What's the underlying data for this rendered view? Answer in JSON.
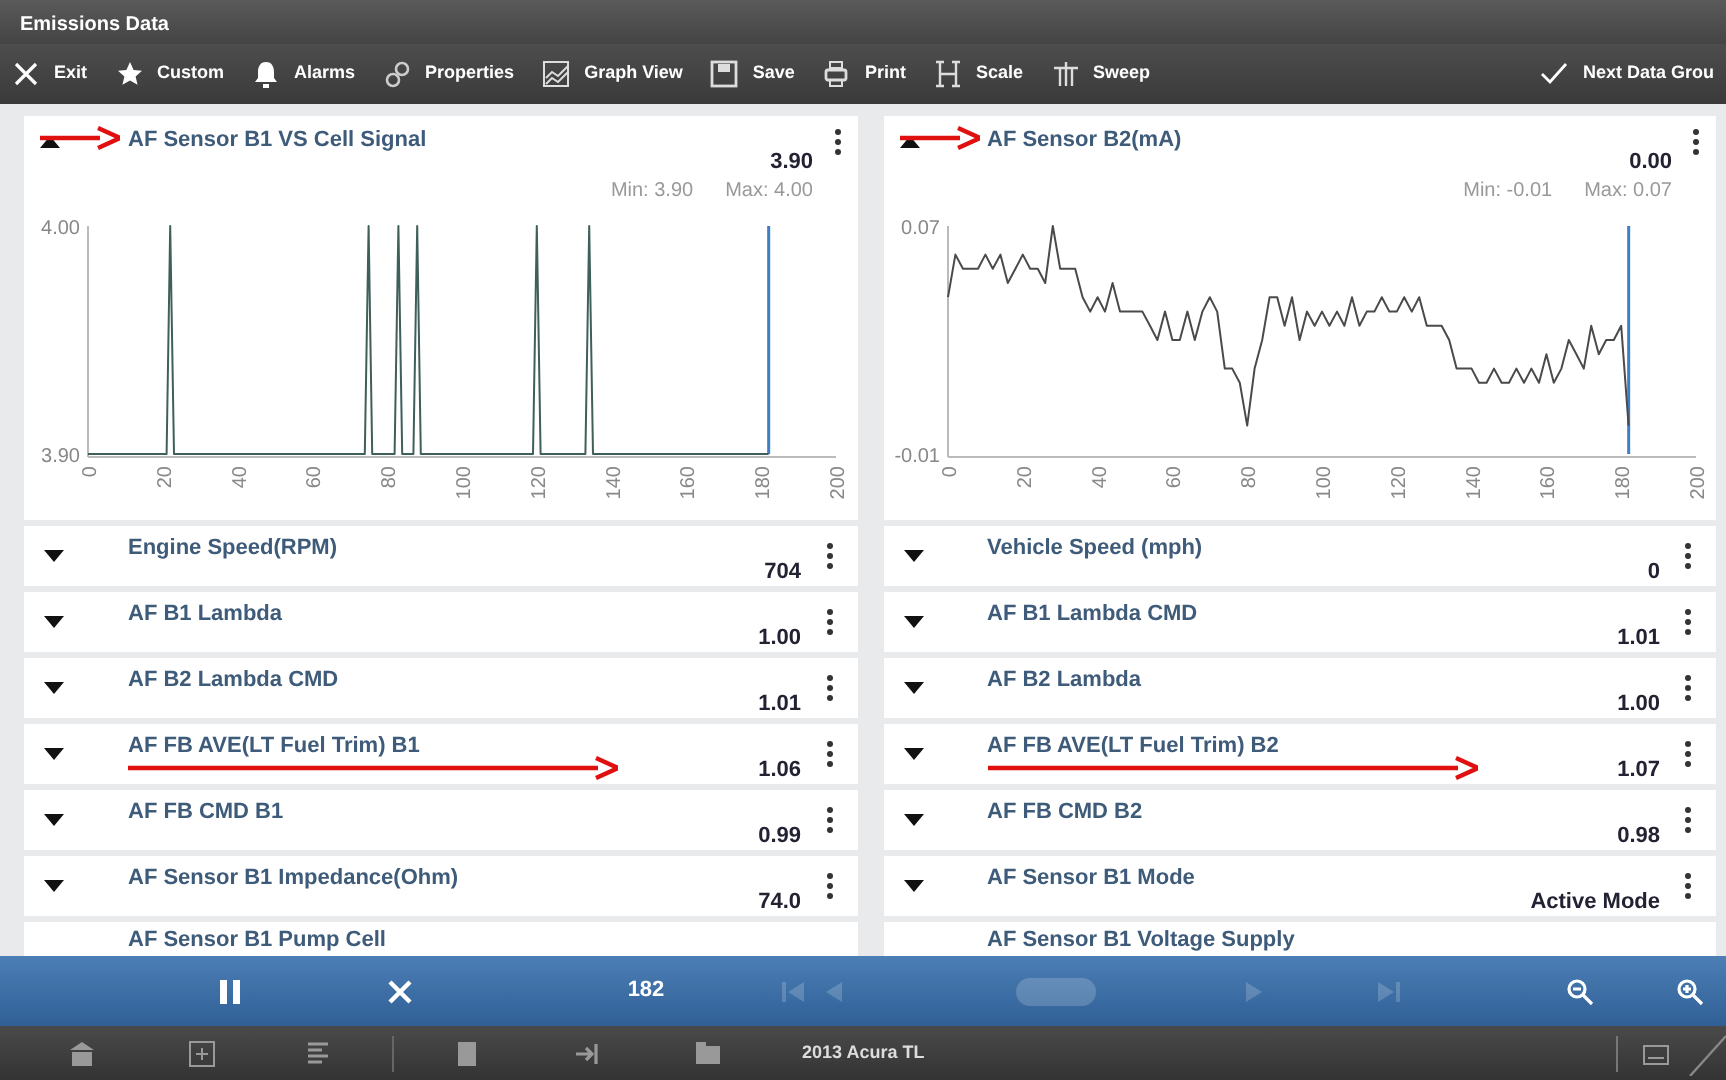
{
  "window": {
    "title": "Emissions Data"
  },
  "toolbar": [
    {
      "kind": "close",
      "label": "Exit"
    },
    {
      "kind": "star",
      "label": "Custom"
    },
    {
      "kind": "bell",
      "label": "Alarms"
    },
    {
      "kind": "gears",
      "label": "Properties"
    },
    {
      "kind": "graph",
      "label": "Graph View"
    },
    {
      "kind": "save",
      "label": "Save"
    },
    {
      "kind": "print",
      "label": "Print"
    },
    {
      "kind": "scale",
      "label": "Scale"
    },
    {
      "kind": "sweep",
      "label": "Sweep"
    },
    {
      "kind": "check",
      "label": "Next Data Grou"
    }
  ],
  "panels": [
    {
      "chart": {
        "title": "AF Sensor B1 VS Cell Signal",
        "value": "3.90",
        "min": "Min: 3.90",
        "max": "Max: 4.00",
        "expanded": true,
        "annotated": true,
        "chart_data": {
          "type": "line",
          "x": [
            0,
            21,
            22,
            23,
            74,
            75,
            76,
            82,
            83,
            84,
            87,
            88,
            89,
            119,
            120,
            121,
            133,
            134,
            135,
            181,
            182
          ],
          "series": [
            {
              "color": "#3f5f5a",
              "values": [
                3.9,
                3.9,
                4.0,
                3.9,
                3.9,
                4.0,
                3.9,
                3.9,
                4.0,
                3.9,
                3.9,
                4.0,
                3.9,
                3.9,
                4.0,
                3.9,
                3.9,
                4.0,
                3.9,
                3.9,
                3.9
              ]
            }
          ],
          "xlim": [
            0,
            200
          ],
          "ylim": [
            3.9,
            4.0
          ],
          "xticks": [
            0,
            20,
            40,
            60,
            80,
            100,
            120,
            140,
            160,
            180,
            200
          ],
          "yticks": [
            {
              "value": 3.9,
              "label": "3.90"
            },
            {
              "value": 4.0,
              "label": "4.00"
            }
          ],
          "ref_lines": [
            {
              "axis": "x",
              "value": 182,
              "color": "#3d7fc4"
            }
          ]
        }
      },
      "rows": [
        {
          "name": "Engine Speed(RPM)",
          "value": "704",
          "expanded": false,
          "annotated": false
        },
        {
          "name": "AF B1 Lambda",
          "value": "1.00",
          "expanded": false,
          "annotated": false
        },
        {
          "name": "AF B2 Lambda CMD",
          "value": "1.01",
          "expanded": false,
          "annotated": false
        },
        {
          "name": "AF FB AVE(LT Fuel Trim) B1",
          "value": "1.06",
          "expanded": false,
          "annotated": true
        },
        {
          "name": "AF FB CMD B1",
          "value": "0.99",
          "expanded": false,
          "annotated": false
        },
        {
          "name": "AF Sensor B1 Impedance(Ohm)",
          "value": "74.0",
          "expanded": false,
          "annotated": false
        },
        {
          "name": "AF Sensor B1 Pump Cell",
          "annotated": false
        }
      ]
    },
    {
      "chart": {
        "title": "AF Sensor B2(mA)",
        "value": "0.00",
        "min": "Min: -0.01",
        "max": "Max: 0.07",
        "expanded": true,
        "annotated": true,
        "chart_data": {
          "type": "line",
          "x": [
            0,
            2,
            4,
            8,
            10,
            12,
            14,
            16,
            18,
            20,
            22,
            24,
            26,
            28,
            30,
            34,
            36,
            38,
            40,
            42,
            44,
            46,
            48,
            52,
            54,
            56,
            58,
            60,
            62,
            64,
            66,
            68,
            70,
            72,
            74,
            76,
            78,
            80,
            82,
            84,
            86,
            88,
            90,
            92,
            94,
            96,
            98,
            100,
            102,
            104,
            106,
            108,
            110,
            112,
            114,
            116,
            118,
            120,
            122,
            124,
            126,
            128,
            130,
            132,
            134,
            136,
            138,
            140,
            142,
            144,
            146,
            148,
            150,
            152,
            154,
            156,
            158,
            160,
            162,
            164,
            166,
            168,
            170,
            172,
            174,
            176,
            178,
            180,
            182
          ],
          "series": [
            {
              "color": "#4a4a4a",
              "values": [
                0.045,
                0.06,
                0.055,
                0.055,
                0.06,
                0.055,
                0.06,
                0.05,
                0.055,
                0.06,
                0.055,
                0.055,
                0.05,
                0.07,
                0.055,
                0.055,
                0.045,
                0.04,
                0.045,
                0.04,
                0.05,
                0.04,
                0.04,
                0.04,
                0.035,
                0.03,
                0.04,
                0.03,
                0.03,
                0.04,
                0.03,
                0.04,
                0.045,
                0.04,
                0.02,
                0.02,
                0.015,
                0.0,
                0.02,
                0.03,
                0.045,
                0.045,
                0.035,
                0.045,
                0.03,
                0.04,
                0.035,
                0.04,
                0.035,
                0.04,
                0.035,
                0.045,
                0.035,
                0.04,
                0.04,
                0.045,
                0.04,
                0.04,
                0.045,
                0.04,
                0.045,
                0.035,
                0.035,
                0.035,
                0.03,
                0.02,
                0.02,
                0.02,
                0.015,
                0.015,
                0.02,
                0.015,
                0.015,
                0.02,
                0.015,
                0.02,
                0.015,
                0.025,
                0.015,
                0.02,
                0.03,
                0.025,
                0.02,
                0.035,
                0.025,
                0.03,
                0.03,
                0.035,
                0.0
              ]
            }
          ],
          "xlim": [
            0,
            200
          ],
          "ylim": [
            -0.01,
            0.07
          ],
          "xticks": [
            0,
            20,
            40,
            60,
            80,
            100,
            120,
            140,
            160,
            180,
            200
          ],
          "yticks": [
            {
              "value": -0.01,
              "label": "-0.01"
            },
            {
              "value": 0.07,
              "label": "0.07"
            }
          ],
          "ref_lines": [
            {
              "axis": "x",
              "value": 182,
              "color": "#3d7fc4"
            }
          ]
        }
      },
      "rows": [
        {
          "name": "Vehicle Speed (mph)",
          "value": "0",
          "expanded": false,
          "annotated": false
        },
        {
          "name": "AF B1 Lambda CMD",
          "value": "1.01",
          "expanded": false,
          "annotated": false
        },
        {
          "name": "AF B2 Lambda",
          "value": "1.00",
          "expanded": false,
          "annotated": false
        },
        {
          "name": "AF FB AVE(LT Fuel Trim) B2",
          "value": "1.07",
          "expanded": false,
          "annotated": true
        },
        {
          "name": "AF FB CMD B2",
          "value": "0.98",
          "expanded": false,
          "annotated": false
        },
        {
          "name": "AF Sensor B1 Mode",
          "value": "Active Mode",
          "expanded": false,
          "annotated": false
        },
        {
          "name": "AF Sensor B1 Voltage Supply",
          "annotated": false
        }
      ]
    }
  ],
  "playback": [
    {
      "kind": "pause",
      "disabled": false
    },
    {
      "kind": "stop",
      "disabled": false
    },
    {
      "kind": "counter",
      "label": "182"
    },
    {
      "kind": "first",
      "disabled": true
    },
    {
      "kind": "back",
      "disabled": true
    },
    {
      "kind": "both",
      "disabled": true
    },
    {
      "kind": "forward",
      "disabled": true
    },
    {
      "kind": "last",
      "disabled": true
    },
    {
      "kind": "zoom-out",
      "disabled": false
    },
    {
      "kind": "zoom-in",
      "disabled": false
    }
  ],
  "taskbar": {
    "vehicle": "2013 Acura TL"
  }
}
